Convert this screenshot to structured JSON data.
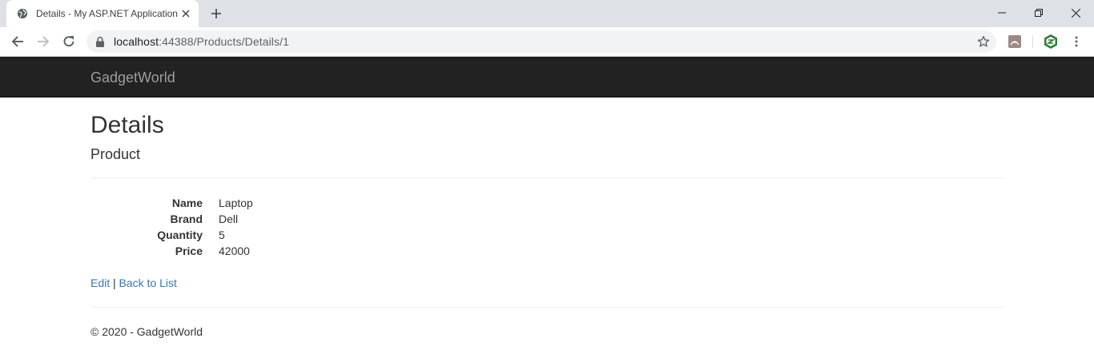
{
  "browser": {
    "tab_title": "Details - My ASP.NET Application",
    "url_host": "localhost",
    "url_path": ":44388/Products/Details/1"
  },
  "site": {
    "brand": "GadgetWorld"
  },
  "page": {
    "title": "Details",
    "subtitle": "Product",
    "fields": [
      {
        "label": "Name",
        "value": "Laptop"
      },
      {
        "label": "Brand",
        "value": "Dell"
      },
      {
        "label": "Quantity",
        "value": "5"
      },
      {
        "label": "Price",
        "value": "42000"
      }
    ],
    "edit_link": "Edit",
    "separator": "|",
    "back_link": "Back to List"
  },
  "footer": {
    "text": "© 2020 - GadgetWorld"
  },
  "colors": {
    "navbar_bg": "#222222",
    "brand_text": "#9d9d9d",
    "link": "#337ab7",
    "text": "#333333"
  },
  "icons": [
    "globe-icon",
    "close-icon",
    "plus-icon",
    "minimize-icon",
    "restore-icon",
    "window-close-icon",
    "back-arrow-icon",
    "forward-arrow-icon",
    "reload-icon",
    "lock-icon",
    "star-icon",
    "pdf-extension-icon",
    "green-extension-icon",
    "more-vert-icon"
  ]
}
